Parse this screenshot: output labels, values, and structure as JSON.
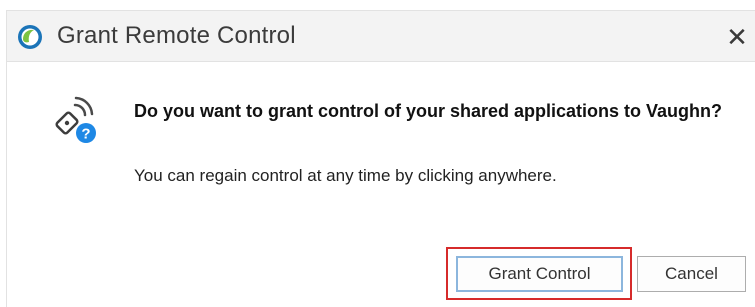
{
  "window": {
    "title": "Grant Remote Control",
    "app_icon": "app-logo-icon",
    "close_glyph": "✕"
  },
  "dialog": {
    "icon": "remote-control-question-icon",
    "question": "Do you want to grant control of your shared applications to Vaughn?",
    "subtext": "You can regain control at any time by clicking anywhere."
  },
  "buttons": {
    "grant_label": "Grant Control",
    "cancel_label": "Cancel"
  },
  "colors": {
    "highlight_border": "#d62b2b",
    "focus_border": "#8cb6dd",
    "question_badge": "#1e88e5",
    "logo_green": "#7cc242",
    "logo_blue": "#1b74b8"
  }
}
